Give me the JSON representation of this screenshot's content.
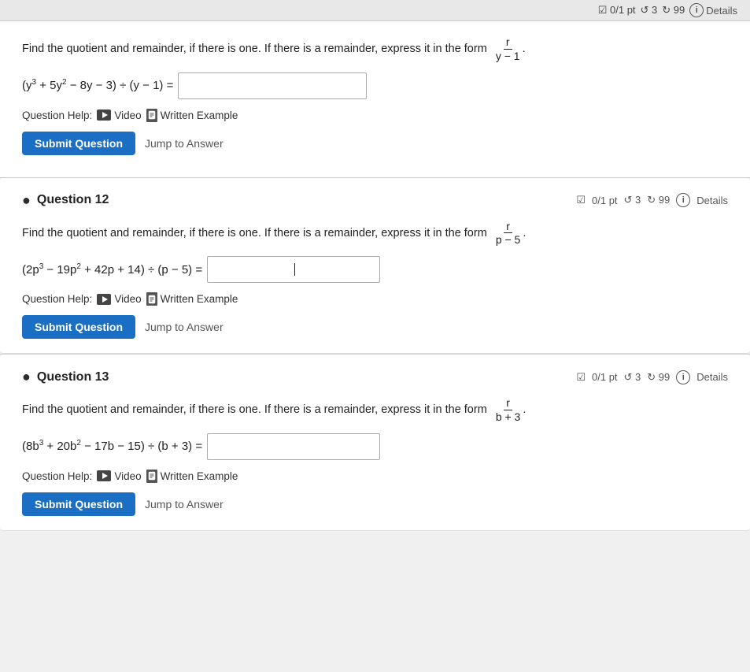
{
  "topbar": {
    "label": "0/1 pt ◯ 3 ↺ 99 Details"
  },
  "section_intro": {
    "instruction": "Find the quotient and remainder, if there is one. If there is a remainder, express it in the form",
    "fraction_numerator": "r",
    "fraction_denominator": "y − 1",
    "equation_left": "(y³ + 5y² − 8y − 3) ÷ (y − 1) =",
    "help_label": "Question Help:",
    "video_label": "Video",
    "written_label": "Written Example",
    "submit_label": "Submit Question",
    "jump_label": "Jump to Answer"
  },
  "question12": {
    "title": "Question 12",
    "meta": "☑ 0/1 pt ↺ 3 ↻ 99",
    "details": "Details",
    "instruction": "Find the quotient and remainder, if there is one. If there is a remainder, express it in the form",
    "fraction_numerator": "r",
    "fraction_denominator": "p − 5",
    "equation_left": "(2p³ − 19p² + 42p + 14) ÷ (p − 5) =",
    "help_label": "Question Help:",
    "video_label": "Video",
    "written_label": "Written Example",
    "submit_label": "Submit Question",
    "jump_label": "Jump to Answer"
  },
  "question13": {
    "title": "Question 13",
    "meta": "☑ 0/1 pt ↺ 3 ↻ 99",
    "details": "Details",
    "instruction": "Find the quotient and remainder, if there is one. If there is a remainder, express it in the form",
    "fraction_numerator": "r",
    "fraction_denominator": "b + 3",
    "equation_left": "(8b³ + 20b² − 17b − 15) ÷ (b + 3) =",
    "help_label": "Question Help:",
    "video_label": "Video",
    "written_label": "Written Example",
    "submit_label": "Submit Question",
    "jump_label": "Jump to Answer"
  }
}
